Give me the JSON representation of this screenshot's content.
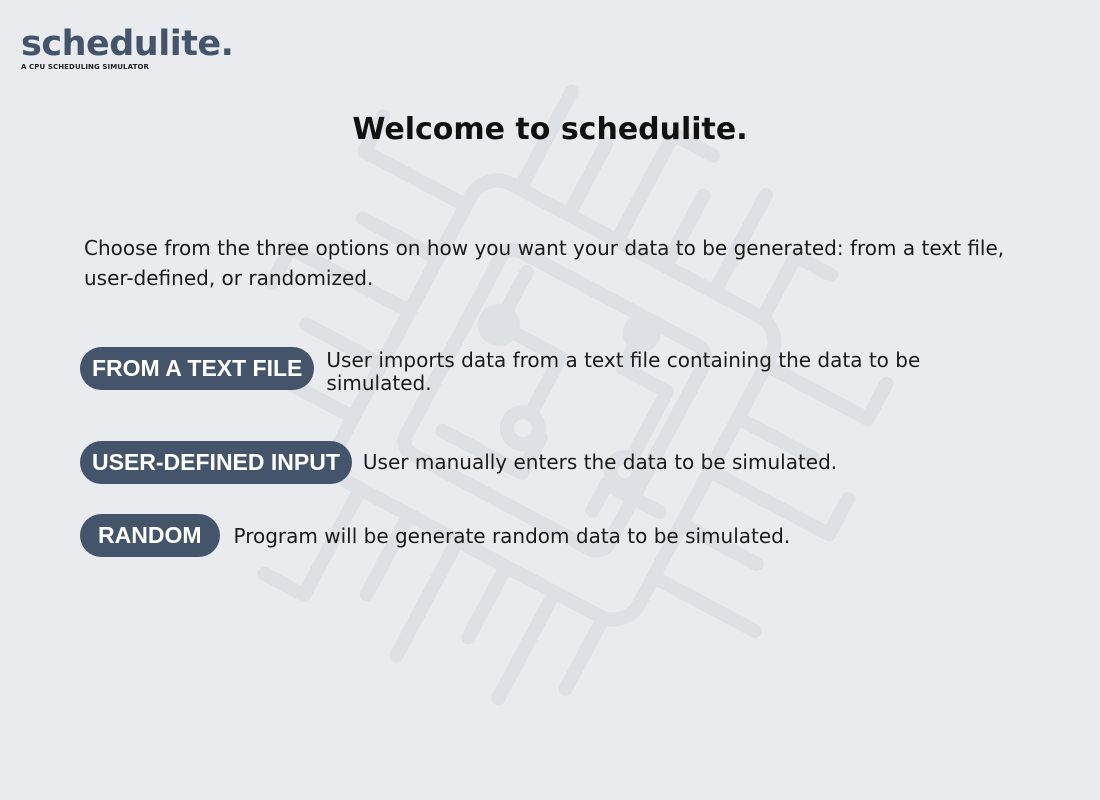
{
  "app": {
    "logo_title": "schedulite.",
    "logo_subtitle": "A CPU SCHEDULING SIMULATOR"
  },
  "main": {
    "heading": "Welcome to schedulite.",
    "intro": "Choose from the three options on how you want your data to be generated: from a text file, user-defined, or randomized.",
    "options": [
      {
        "label": "FROM A TEXT FILE",
        "description": "User imports data from a text file containing the data to be simulated."
      },
      {
        "label": "USER-DEFINED INPUT",
        "description": "User manually enters the data to be simulated."
      },
      {
        "label": "RANDOM",
        "description": "Program will be generate random data to be simulated."
      }
    ]
  },
  "colors": {
    "background": "#e9ebee",
    "accent": "#44546a",
    "watermark": "#dfe2e6"
  },
  "icons": {
    "background": "cpu-circuit-watermark"
  }
}
